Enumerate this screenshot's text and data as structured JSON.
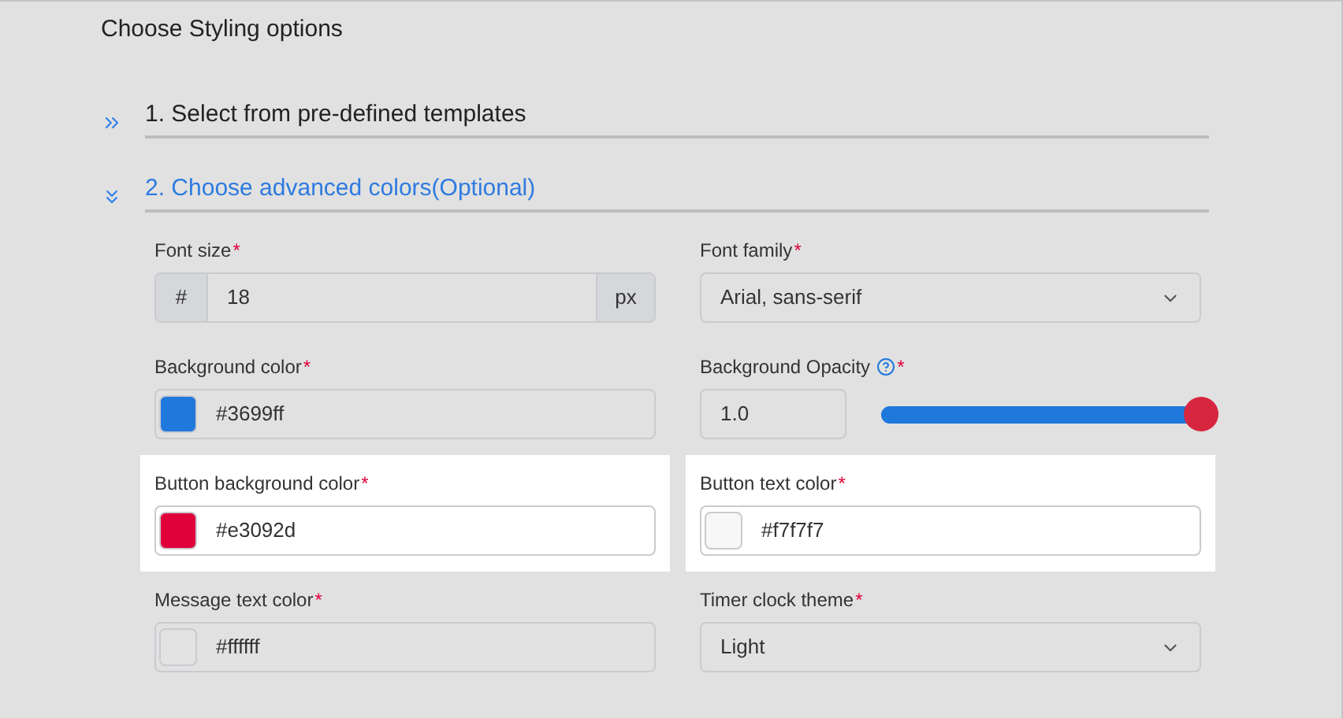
{
  "title": "Choose Styling options",
  "sections": [
    {
      "title": "1. Select from pre-defined templates",
      "expanded": false
    },
    {
      "title": "2. Choose advanced colors(Optional)",
      "expanded": true,
      "fields": [
        {
          "kind": "number",
          "label": "Font size",
          "required_mark": "*",
          "prefix": "#",
          "value": "18",
          "suffix": "px",
          "highlighted": false
        },
        {
          "kind": "select",
          "label": "Font family",
          "required_mark": "*",
          "value": "Arial, sans-serif",
          "highlighted": false
        },
        {
          "kind": "color",
          "label": "Background color",
          "required_mark": "*",
          "value": "#3699ff",
          "color": "#1f78dc",
          "highlighted": false
        },
        {
          "kind": "opacity",
          "label": "Background Opacity",
          "help": true,
          "required_mark": "*",
          "value": "1.0",
          "level": 1,
          "highlighted": false
        },
        {
          "kind": "color",
          "label": "Button background color",
          "required_mark": "*",
          "value": "#e3092d",
          "color": "#e0003a",
          "highlighted": true
        },
        {
          "kind": "color",
          "label": "Button text color",
          "required_mark": "*",
          "value": "#f7f7f7",
          "color": "#f7f7f7",
          "highlighted": true
        },
        {
          "kind": "color",
          "label": "Message text color",
          "required_mark": "*",
          "value": "#ffffff",
          "color": "#e3e3e3",
          "highlighted": false
        },
        {
          "kind": "select",
          "label": "Timer clock theme",
          "required_mark": "*",
          "value": "Light",
          "highlighted": false
        }
      ]
    }
  ]
}
